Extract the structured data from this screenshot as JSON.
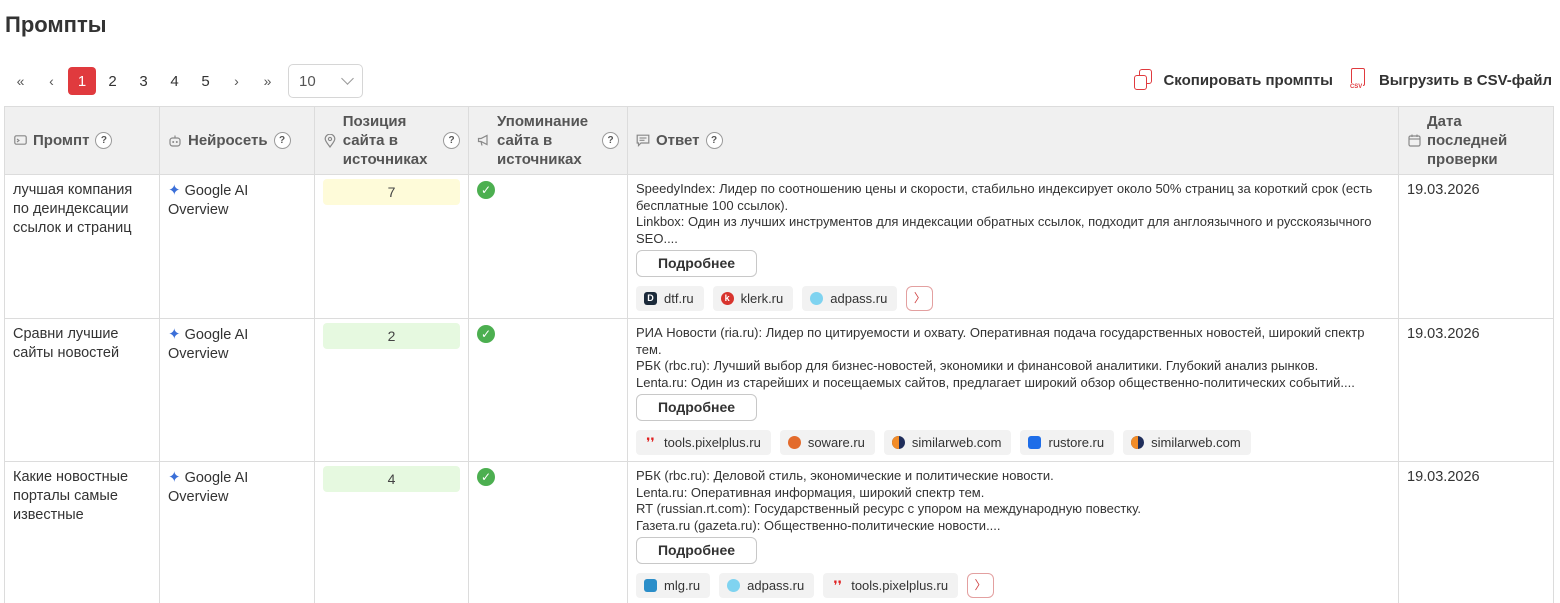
{
  "page": {
    "title": "Промпты"
  },
  "pagination": {
    "first_icon": "«",
    "prev_icon": "‹",
    "pages": [
      "1",
      "2",
      "3",
      "4",
      "5"
    ],
    "active_page": "1",
    "next_icon": "›",
    "last_icon": "»",
    "per_page": "10"
  },
  "actions": {
    "copy_label": "Скопировать промпты",
    "csv_label": "Выгрузить в CSV-файл",
    "csv_icon_text": "CSV"
  },
  "table": {
    "headers": {
      "prompt": "Промпт",
      "model": "Нейросеть",
      "position_l1": "Позиция",
      "position_l2": "сайта в",
      "position_l3": "источниках",
      "mention_l1": "Упоминание",
      "mention_l2": "сайта в",
      "mention_l3": "источниках",
      "answer": "Ответ",
      "date_l1": "Дата",
      "date_l2": "последней",
      "date_l3": "проверки",
      "help": "?"
    },
    "more_label": "Подробнее",
    "rows": [
      {
        "prompt": "лучшая компания по деиндексации ссылок и страниц",
        "model": "Google AI Overview",
        "position": "7",
        "answer_lines": [
          "SpeedyIndex: Лидер по соотношению цены и скорости, стабильно индексирует около 50% страниц за короткий срок (есть бесплатные 100 ссылок).",
          "Linkbox: Один из лучших инструментов для индексации обратных ссылок, подходит для англоязычного и русскоязычного SEO...."
        ],
        "sources": [
          "dtf.ru",
          "klerk.ru",
          "adpass.ru"
        ],
        "date": "19.03.2026"
      },
      {
        "prompt": "Сравни лучшие сайты новостей",
        "model": "Google AI Overview",
        "position": "2",
        "answer_lines": [
          "РИА Новости (ria.ru): Лидер по цитируемости и охвату. Оперативная подача государственных новостей, широкий спектр тем.",
          "РБК (rbc.ru): Лучший выбор для бизнес-новостей, экономики и финансовой аналитики. Глубокий анализ рынков.",
          "Lenta.ru: Один из старейших и посещаемых сайтов, предлагает широкий обзор общественно-политических событий...."
        ],
        "sources": [
          "tools.pixelplus.ru",
          "soware.ru",
          "similarweb.com",
          "rustore.ru",
          "similarweb.com"
        ],
        "date": "19.03.2026"
      },
      {
        "prompt": "Какие новостные порталы самые известные",
        "model": "Google AI Overview",
        "position": "4",
        "answer_lines": [
          "РБК (rbc.ru): Деловой стиль, экономические и политические новости.",
          "Lenta.ru: Оперативная информация, широкий спектр тем.",
          "RT (russian.rt.com): Государственный ресурс с упором на международную повестку.",
          "Газета.ru (gazeta.ru): Общественно-политические новости...."
        ],
        "sources": [
          "mlg.ru",
          "adpass.ru",
          "tools.pixelplus.ru"
        ],
        "date": "19.03.2026"
      }
    ]
  },
  "colors": {
    "accent": "#e03a3e",
    "check": "#4caf50",
    "position_yellow": "#fefbd9",
    "position_green": "#e6f9e0",
    "header_bg": "#f0f0f0"
  },
  "icons": {
    "copy": "copy-icon",
    "csv": "csv-file-icon",
    "prompt_header": "message-icon",
    "model_header": "robot-icon",
    "position_header": "location-pin-icon",
    "mention_header": "megaphone-icon",
    "answer_header": "chat-icon",
    "date_header": "calendar-icon",
    "model": "google-ai-star-icon",
    "mention": "check-circle-icon",
    "more_sources": "chevron-right-icon"
  }
}
